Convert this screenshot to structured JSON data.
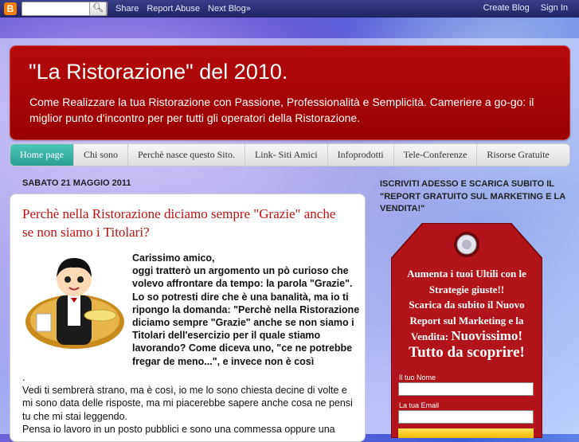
{
  "navbar": {
    "logo": "B",
    "search_button": "Q",
    "links": [
      "Share",
      "Report Abuse",
      "Next Blog»"
    ],
    "right_links": [
      "Create Blog",
      "Sign In"
    ]
  },
  "header": {
    "title": "\"La Ristorazione\" del 2010.",
    "description": "Come Realizzare la tua Ristorazione con Passione, Professionalità e Semplicità. Cameriere a go-go: il miglior punto d'incontro per per tutti gli operatori della Ristorazione."
  },
  "tabs": [
    "Home page",
    "Chi sono",
    "Perchè nasce questo Sito.",
    "Link- Siti Amici",
    "Infoprodotti",
    "Tele-Conferenze",
    "Risorse Gratuite"
  ],
  "post": {
    "date": "SABATO 21 MAGGIO 2011",
    "title": "Perchè nella Ristorazione diciamo sempre \"Grazie\" anche se non siamo i Titolari?",
    "intro_bold": "Carissimo amico,\noggi tratterò un argomento un pò curioso che volevo affrontare da tempo: la parola \"Grazie\". Lo so potresti dire che è una banalità, ma io ti ripongo la domanda:  \"Perchè nella Ristorazione diciamo sempre \"Grazie\" anche se non siamo i Titolari dell'esercizio per il quale stiamo lavorando? Come diceva uno, \"ce ne potrebbe fregar de meno...\", e invece non è così",
    "body": ".\nVedi ti sembrerà strano, ma è così, io me lo sono chiesta decine di volte e mi sono data delle risposte, ma mi piacerebbe sapere anche cosa ne pensi tu che mi stai leggendo.\nPensa io lavoro in un posto pubblici e sono una commessa oppure una"
  },
  "sidebar": {
    "title": "ISCRIVITI ADESSO E SCARICA SUBITO IL \"REPORT GRATUITO SUL MARKETING E LA VENDITA!\"",
    "tag_line1": "Aumenta i tuoi Ultili con le Strategie giuste!!",
    "tag_line2": "Scarica da subito il Nuovo Report sul Marketing e la Vendita: ",
    "tag_highlight": "Nuovissimo!",
    "tag_line3": "Tutto da scoprire!",
    "name_label": "Il tuo Nome",
    "email_label": "La tua Email"
  },
  "colors": {
    "header_red": "#a80000",
    "active_tab": "#2fa89b",
    "post_title": "#c31111",
    "tag_red": "#b3141b"
  }
}
